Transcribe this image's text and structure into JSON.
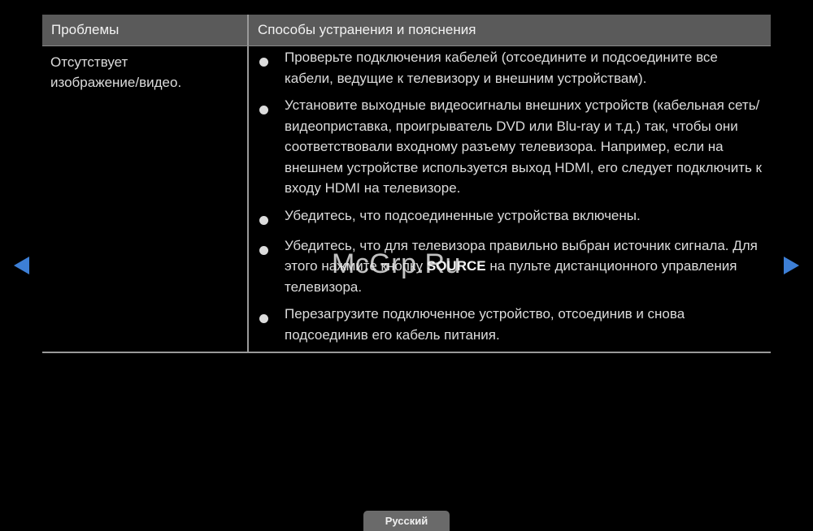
{
  "table": {
    "header_problems": "Проблемы",
    "header_solutions": "Способы устранения и пояснения",
    "problem": "Отсутствует\nизображение/видео.",
    "solutions": [
      {
        "text": "Проверьте подключения кабелей (отсоедините и подсоедините все кабели, ведущие к телевизору и внешним устройствам)."
      },
      {
        "text": "Установите выходные видеосигналы внешних устройств (кабельная сеть/видеоприставка, проигрыватель DVD или Blu-ray и т.д.) так, чтобы они соответствовали входному разъему телевизора. Например, если на внешнем устройстве используется выход HDMI, его следует подключить к входу HDMI на телевизоре."
      },
      {
        "before": "Убедитесь, что подсоединенные устройства включены."
      },
      {
        "before": "Убедитесь, что для телевизора правильно выбран источник сигнала. Для этого нажмите кнопку ",
        "bold": "SOURCE",
        "after": " на пульте дистанционного управления телевизора."
      },
      {
        "text": "Перезагрузите подключенное устройство, отсоединив и снова подсоединив его кабель питания."
      }
    ]
  },
  "navigation": {
    "prev_icon": "triangle-left-icon",
    "next_icon": "triangle-right-icon",
    "accent_color": "#3d7fd6"
  },
  "watermark": "McGrp.Ru",
  "footer": {
    "language": "Русский"
  }
}
